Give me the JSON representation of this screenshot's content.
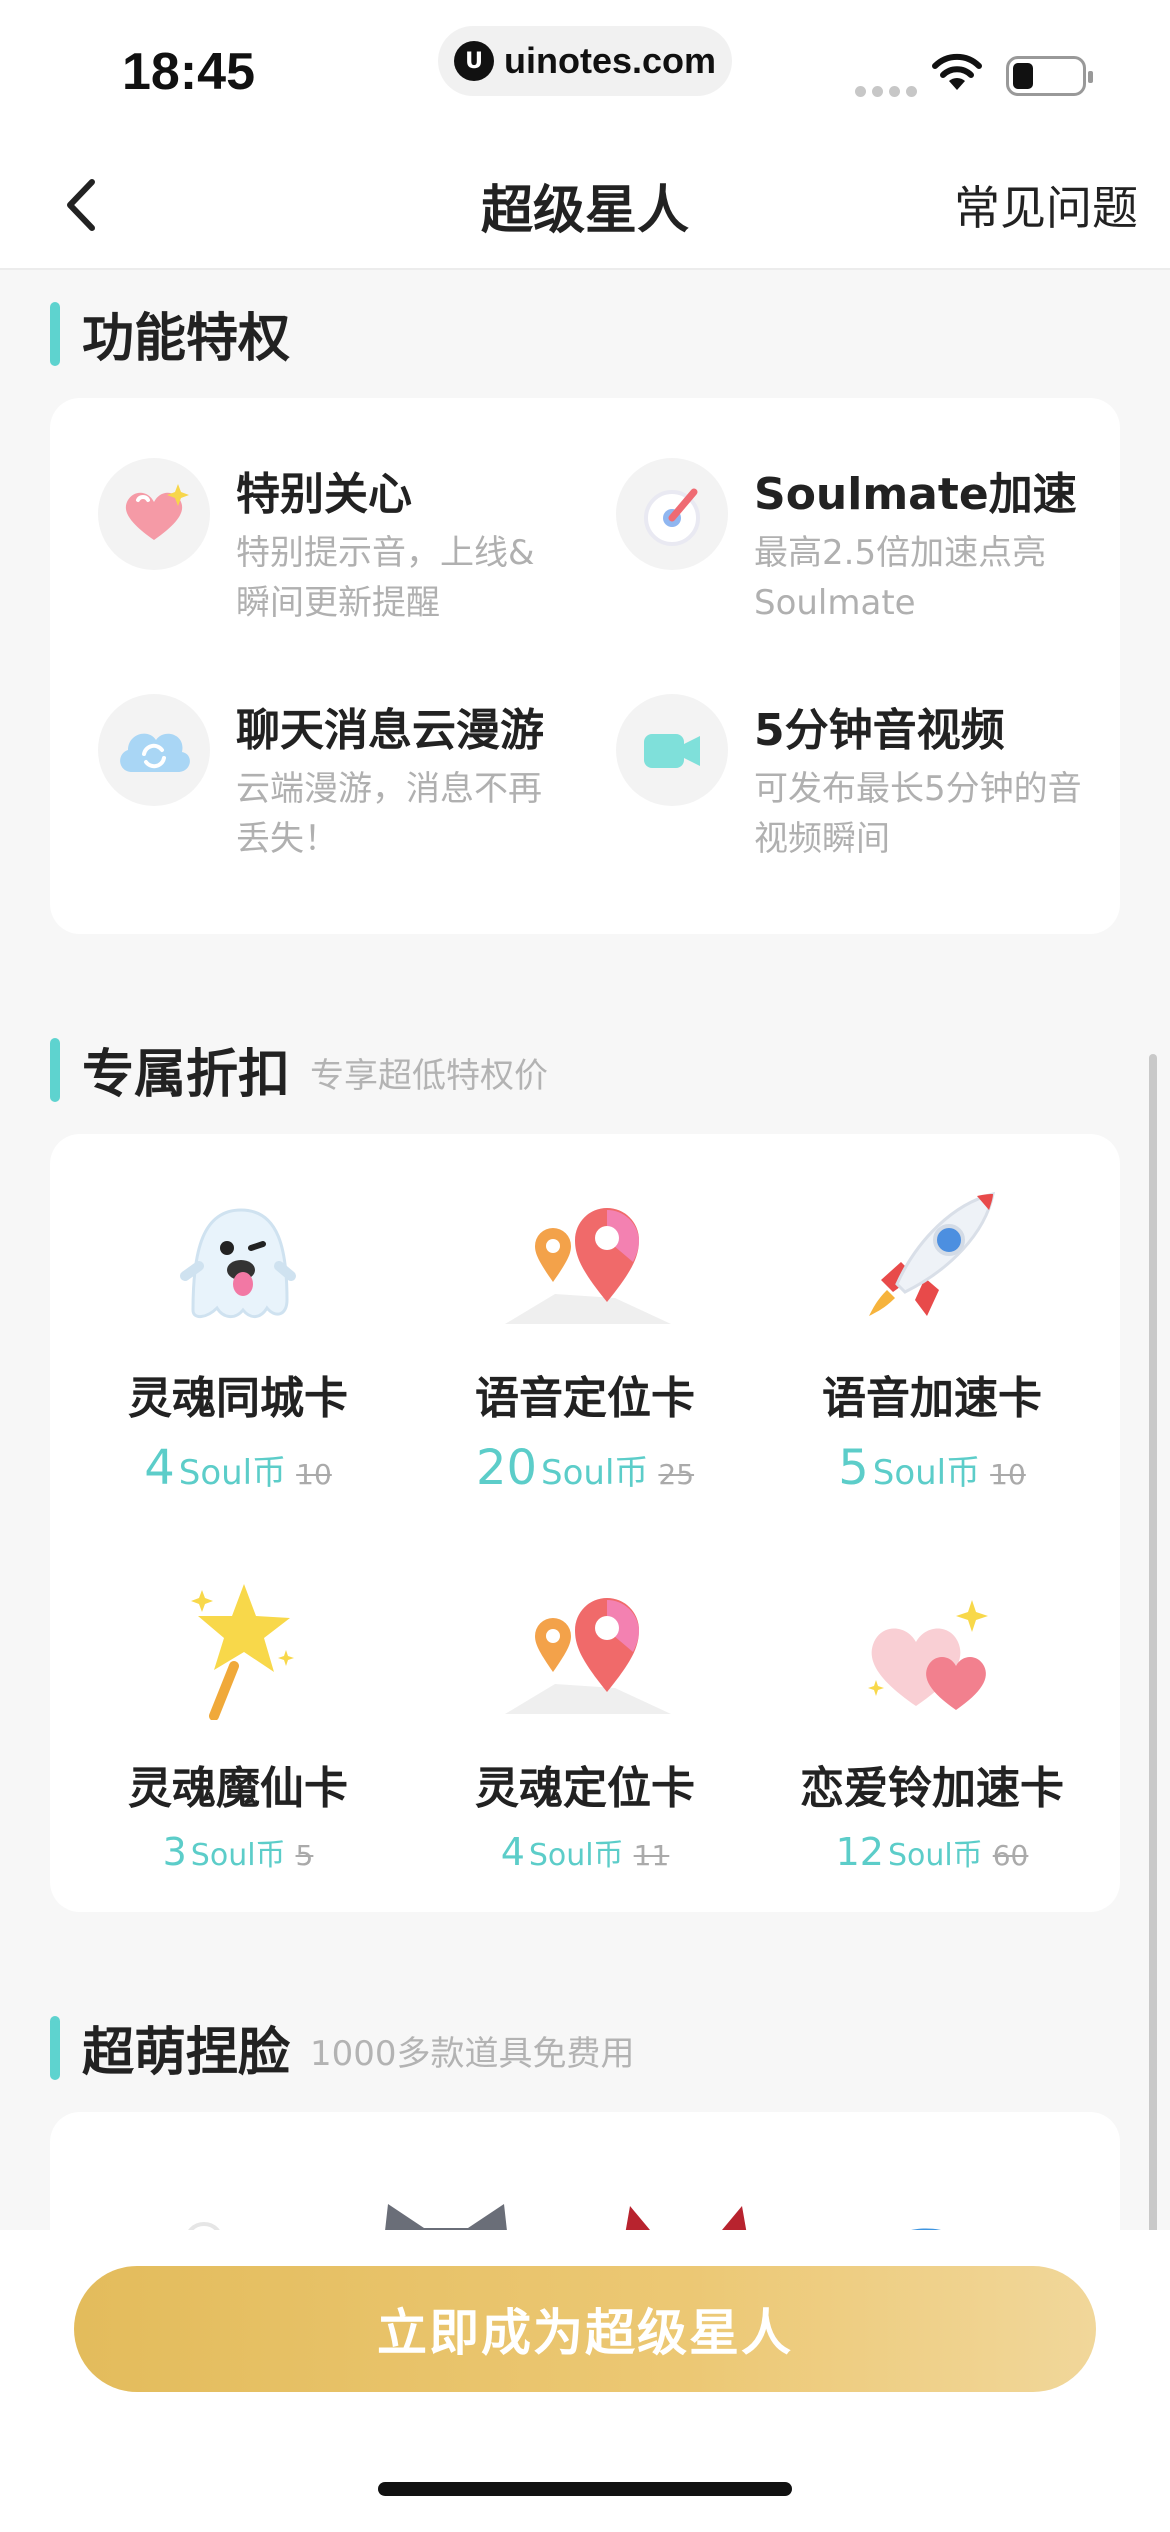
{
  "status_bar": {
    "time": "18:45",
    "url_logo": "U",
    "url": "uinotes.com"
  },
  "nav": {
    "title": "超级星人",
    "faq": "常见问题"
  },
  "features_section": {
    "title": "功能特权",
    "items": [
      {
        "icon": "heart-icon",
        "title": "特别关心",
        "desc": "特别提示音，上线&瞬间更新提醒"
      },
      {
        "icon": "speed-gauge-icon",
        "title": "Soulmate加速",
        "desc": "最高2.5倍加速点亮Soulmate"
      },
      {
        "icon": "cloud-sync-icon",
        "title": "聊天消息云漫游",
        "desc": "云端漫游，消息不再丢失！"
      },
      {
        "icon": "video-icon",
        "title": "5分钟音视频",
        "desc": "可发布最长5分钟的音视频瞬间"
      }
    ]
  },
  "discount_section": {
    "title": "专属折扣",
    "subtitle": "专享超低特权价",
    "items": [
      {
        "icon": "ghost-icon",
        "name": "灵魂同城卡",
        "price": "4",
        "unit": "Soul币",
        "old_price": "10"
      },
      {
        "icon": "location-pin-icon",
        "name": "语音定位卡",
        "price": "20",
        "unit": "Soul币",
        "old_price": "25"
      },
      {
        "icon": "rocket-icon",
        "name": "语音加速卡",
        "price": "5",
        "unit": "Soul币",
        "old_price": "10"
      },
      {
        "icon": "magic-wand-icon",
        "name": "灵魂魔仙卡",
        "price": "3",
        "unit": "Soul币",
        "old_price": "5"
      },
      {
        "icon": "location-pin-icon",
        "name": "灵魂定位卡",
        "price": "4",
        "unit": "Soul币",
        "old_price": "11"
      },
      {
        "icon": "hearts-icon",
        "name": "恋爱铃加速卡",
        "price": "12",
        "unit": "Soul币",
        "old_price": "60"
      }
    ]
  },
  "faces_section": {
    "title": "超萌捏脸",
    "subtitle": "1000多款道具免费用"
  },
  "cta": {
    "label": "立即成为超级星人"
  },
  "colors": {
    "accent": "#5ed3cf",
    "cta_gold": "#e8c46a"
  }
}
